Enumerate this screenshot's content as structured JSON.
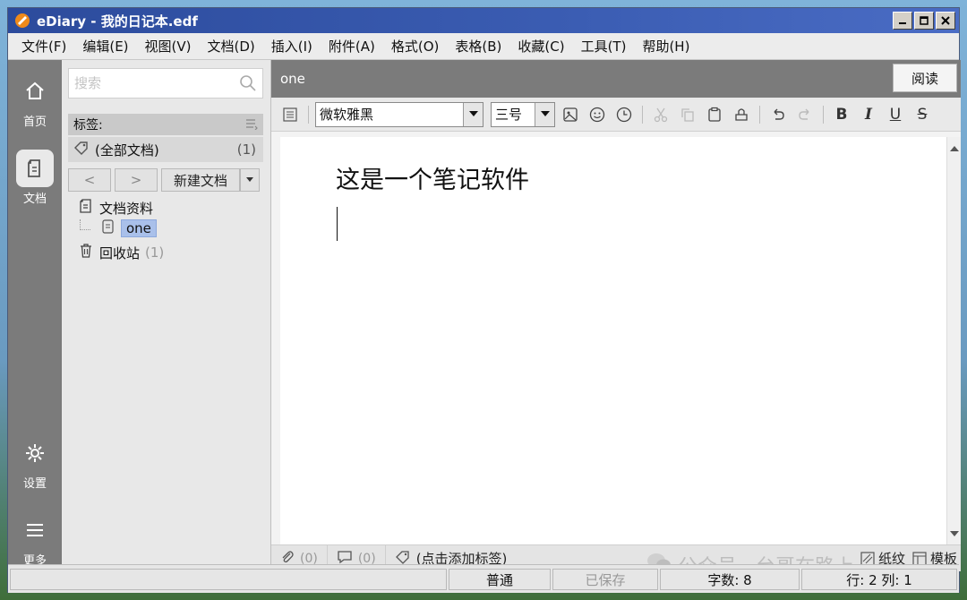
{
  "window": {
    "title": "eDiary - 我的日记本.edf"
  },
  "menu": [
    "文件(F)",
    "编辑(E)",
    "视图(V)",
    "文档(D)",
    "插入(I)",
    "附件(A)",
    "格式(O)",
    "表格(B)",
    "收藏(C)",
    "工具(T)",
    "帮助(H)"
  ],
  "rail": {
    "home": "首页",
    "docs": "文档",
    "settings": "设置",
    "more": "更多"
  },
  "sidebar": {
    "search_placeholder": "搜索",
    "tag_header": "标签:",
    "all_docs": "(全部文档)",
    "all_docs_count": "(1)",
    "prev": "<",
    "next": ">",
    "new_doc": "新建文档",
    "folder": "文档资料",
    "doc": "one",
    "recycle": "回收站",
    "recycle_count": "(1)"
  },
  "doc": {
    "title": "one",
    "read_button": "阅读",
    "heading": "这是一个笔记软件"
  },
  "toolbar": {
    "font": "微软雅黑",
    "size": "三号",
    "bold": "B",
    "italic": "I",
    "underline": "U",
    "strike": "S"
  },
  "bottom": {
    "attach_count": "(0)",
    "comment_count": "(0)",
    "add_tag": "(点击添加标签)",
    "watermark": "公众号 · 台哥在路上",
    "paper": "纸纹",
    "template": "模板"
  },
  "status": {
    "mode": "普通",
    "saved": "已保存",
    "chars": "字数: 8",
    "position": "行: 2  列: 1"
  },
  "colors": {
    "titlebar": "#2c4b9c",
    "rail": "#7b7b7b",
    "selection": "#a9c0ea"
  }
}
